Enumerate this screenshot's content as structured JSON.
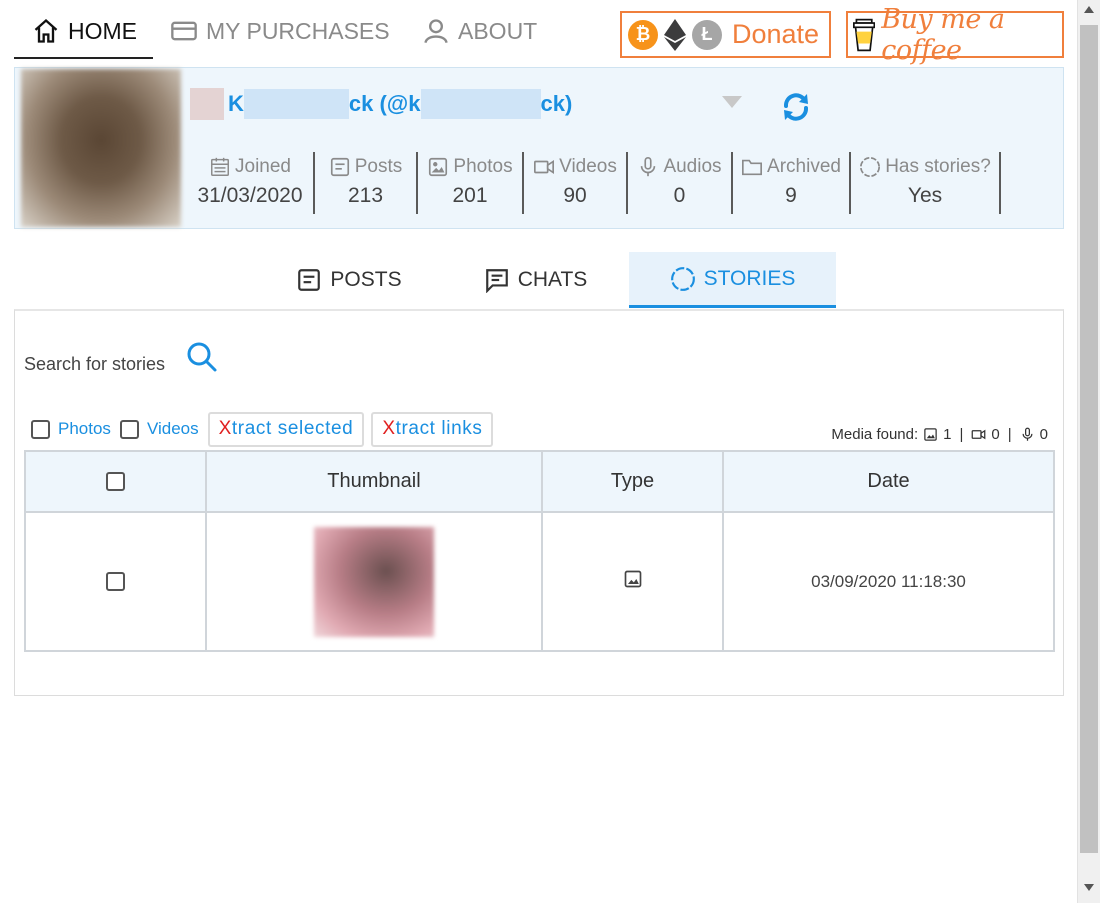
{
  "nav": {
    "home": "HOME",
    "purchases": "MY PURCHASES",
    "about": "ABOUT",
    "donate": "Donate",
    "coffee": "Buy me a coffee"
  },
  "profile": {
    "name_part1": "K",
    "name_part2": "ck (@k",
    "name_part3": "ck)",
    "stats": [
      {
        "label": "Joined",
        "value": "31/03/2020",
        "icon": "calendar-icon"
      },
      {
        "label": "Posts",
        "value": "213",
        "icon": "post-icon"
      },
      {
        "label": "Photos",
        "value": "201",
        "icon": "image-icon"
      },
      {
        "label": "Videos",
        "value": "90",
        "icon": "video-icon"
      },
      {
        "label": "Audios",
        "value": "0",
        "icon": "microphone-icon"
      },
      {
        "label": "Archived",
        "value": "9",
        "icon": "folder-icon"
      },
      {
        "label": "Has stories?",
        "value": "Yes",
        "icon": "stories-ring-icon"
      }
    ]
  },
  "subtabs": {
    "posts": "POSTS",
    "chats": "CHATS",
    "stories": "STORIES"
  },
  "stories": {
    "search_label": "Search for stories",
    "filter_photos": "Photos",
    "filter_videos": "Videos",
    "xtract_selected_x": "X",
    "xtract_selected_rest": "tract selected",
    "xtract_links_x": "X",
    "xtract_links_rest": "tract links",
    "media_found_label": "Media found:",
    "media_found_photos": "1",
    "media_found_videos": "0",
    "media_found_audios": "0"
  },
  "table": {
    "headers": [
      "",
      "Thumbnail",
      "Type",
      "Date"
    ],
    "rows": [
      {
        "type_icon": "image-icon",
        "date": "03/09/2020 11:18:30"
      }
    ]
  },
  "colors": {
    "accent": "#1a8fe0",
    "donate": "#f07f3c",
    "xtract_x": "#e02020"
  }
}
